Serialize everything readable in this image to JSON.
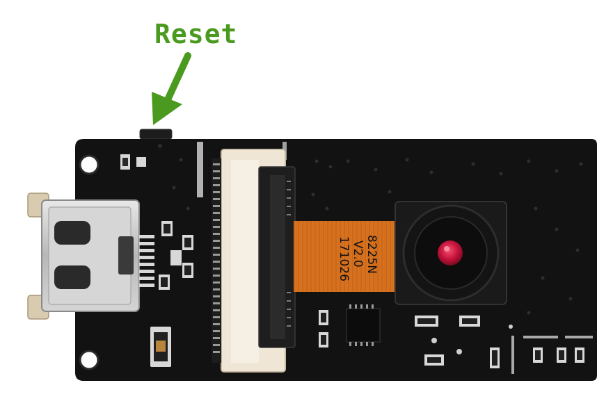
{
  "annotation": {
    "label": "Reset",
    "color": "#4a9a1f"
  },
  "camera_flex_marking": {
    "line1": "8225N",
    "line2": "V2.0",
    "line3": "171026"
  },
  "colors": {
    "pcb": "#121212",
    "flex_cable": "#d8731e",
    "connector": "#efe6d6",
    "lens_center": "#c4123a",
    "usb_metal": "#c9c9c9"
  }
}
